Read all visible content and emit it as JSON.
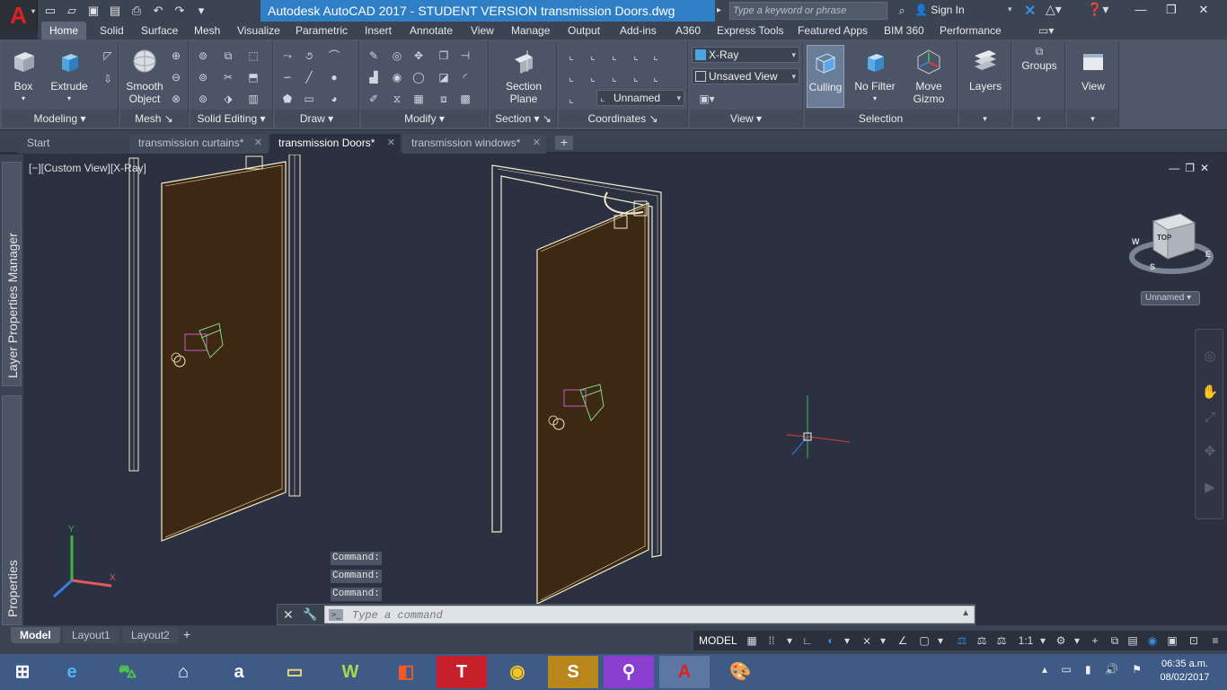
{
  "app": {
    "logo": "A",
    "title": "Autodesk AutoCAD 2017 - STUDENT VERSION    transmission Doors.dwg",
    "search_placeholder": "Type a keyword or phrase",
    "sign_in": "Sign In"
  },
  "ribbon_tabs": [
    "Home",
    "Solid",
    "Surface",
    "Mesh",
    "Visualize",
    "Parametric",
    "Insert",
    "Annotate",
    "View",
    "Manage",
    "Output",
    "Add-ins",
    "A360",
    "Express Tools",
    "Featured Apps",
    "BIM 360",
    "Performance"
  ],
  "active_ribbon_tab": "Home",
  "ribbon": {
    "box": "Box",
    "extrude": "Extrude",
    "smooth_object_1": "Smooth",
    "smooth_object_2": "Object",
    "section_plane_1": "Section",
    "section_plane_2": "Plane",
    "visual_style": "X-Ray",
    "named_view": "Unsaved View",
    "ucs_named": "Unnamed",
    "culling": "Culling",
    "no_filter": "No Filter",
    "move_gizmo_1": "Move",
    "move_gizmo_2": "Gizmo",
    "layers": "Layers",
    "groups": "Groups",
    "view": "View",
    "panels": {
      "modeling": "Modeling",
      "mesh": "Mesh",
      "solid_editing": "Solid Editing",
      "draw": "Draw",
      "modify": "Modify",
      "section": "Section",
      "coordinates": "Coordinates",
      "view": "View",
      "selection": "Selection"
    }
  },
  "file_tabs": {
    "start": "Start",
    "tabs": [
      "transmission curtains*",
      "transmission Doors*",
      "transmission windows*"
    ],
    "active": "transmission Doors*"
  },
  "palettes": {
    "layer_props": "Layer Properties Manager",
    "properties": "Properties"
  },
  "viewport": {
    "label": "[−][Custom View][X-Ray]",
    "viewcube_face": "TOP",
    "compass_w": "W",
    "compass_s": "S",
    "compass_e": "E",
    "wcs": "Unnamed",
    "ucs_y": "Y",
    "ucs_x": "X"
  },
  "command": {
    "history": [
      "Command:",
      "Command:",
      "Command:"
    ],
    "placeholder": "Type a command"
  },
  "layout_tabs": [
    "Model",
    "Layout1",
    "Layout2"
  ],
  "status": {
    "model": "MODEL",
    "scale": "1:1"
  },
  "taskbar": {
    "time": "06:35 a.m.",
    "date": "08/02/2017"
  }
}
